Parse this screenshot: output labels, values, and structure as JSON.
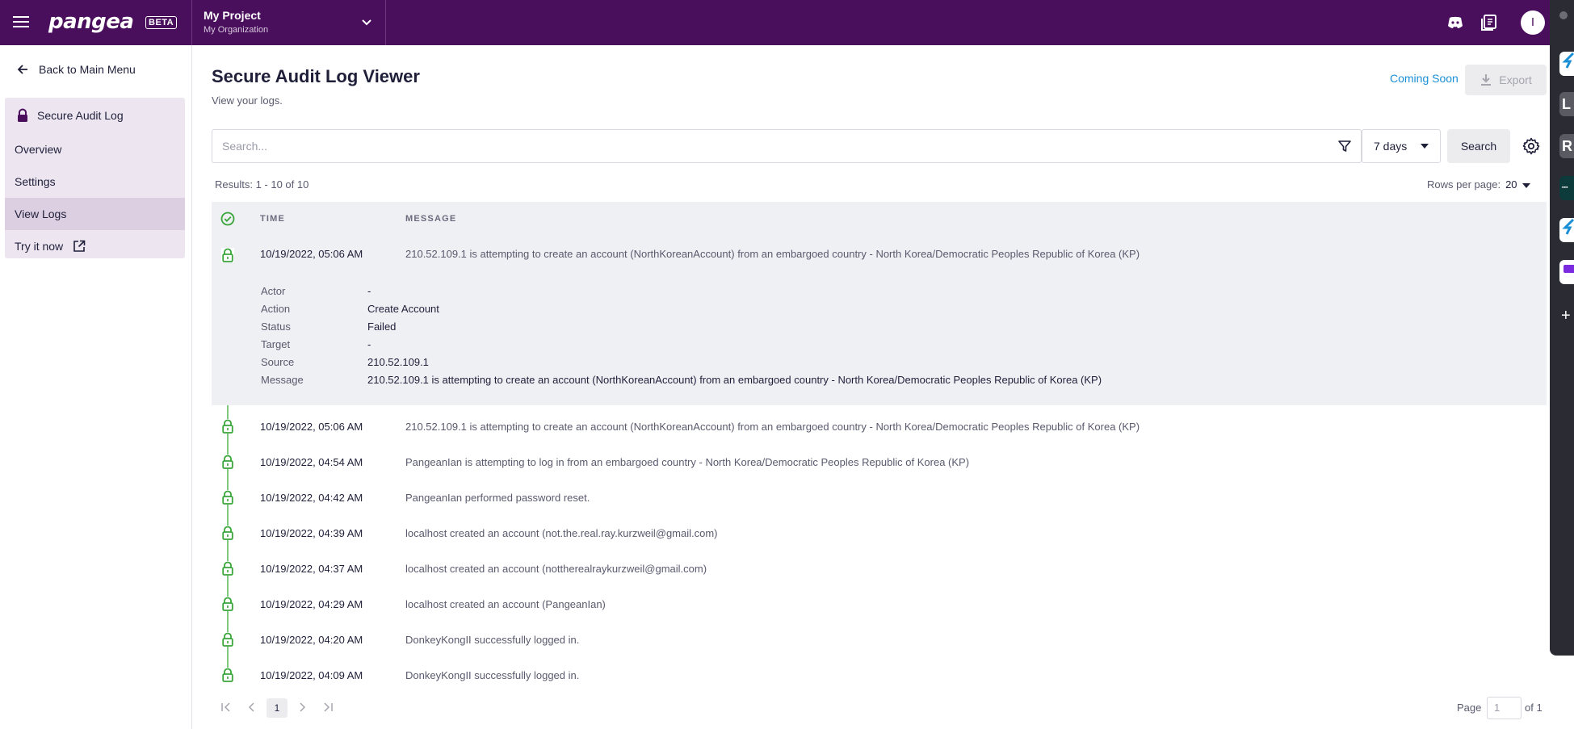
{
  "app": {
    "logo_text": "pangea",
    "badge": "BETA",
    "project_name": "My Project",
    "organization": "My Organization",
    "user_initial": "I"
  },
  "sidebar": {
    "back_label": "Back to Main Menu",
    "section_title": "Secure Audit Log",
    "items": [
      {
        "label": "Overview",
        "active": false
      },
      {
        "label": "Settings",
        "active": false
      },
      {
        "label": "View Logs",
        "active": true
      },
      {
        "label": "Try it now",
        "active": false,
        "external": true
      }
    ]
  },
  "page": {
    "title": "Secure Audit Log Viewer",
    "subtitle": "View your logs.",
    "coming_soon": "Coming Soon",
    "export_label": "Export"
  },
  "search": {
    "placeholder": "Search...",
    "range": "7 days",
    "button": "Search"
  },
  "results": {
    "summary": "Results: 1 - 10 of 10",
    "rows_per_page_label": "Rows per page:",
    "rows_per_page": "20"
  },
  "table": {
    "columns": [
      "TIME",
      "MESSAGE"
    ],
    "expanded_row": {
      "time": "10/19/2022, 05:06 AM",
      "message": "210.52.109.1 is attempting to create an account (NorthKoreanAccount) from an embargoed country - North Korea/Democratic Peoples Republic of Korea (KP)",
      "details": [
        {
          "key": "Actor",
          "value": "-"
        },
        {
          "key": "Action",
          "value": "Create Account"
        },
        {
          "key": "Status",
          "value": "Failed"
        },
        {
          "key": "Target",
          "value": "-"
        },
        {
          "key": "Source",
          "value": "210.52.109.1"
        },
        {
          "key": "Message",
          "value": "210.52.109.1 is attempting to create an account (NorthKoreanAccount) from an embargoed country - North Korea/Democratic Peoples Republic of Korea (KP)"
        }
      ]
    },
    "rows": [
      {
        "time": "10/19/2022, 05:06 AM",
        "message": "210.52.109.1 is attempting to create an account (NorthKoreanAccount) from an embargoed country - North Korea/Democratic Peoples Republic of Korea (KP)"
      },
      {
        "time": "10/19/2022, 04:54 AM",
        "message": "PangeanIan is attempting to log in from an embargoed country - North Korea/Democratic Peoples Republic of Korea (KP)"
      },
      {
        "time": "10/19/2022, 04:42 AM",
        "message": "PangeanIan performed password reset."
      },
      {
        "time": "10/19/2022, 04:39 AM",
        "message": "localhost created an account (not.the.real.ray.kurzweil@gmail.com)"
      },
      {
        "time": "10/19/2022, 04:37 AM",
        "message": "localhost created an account (nottherealraykurzweil@gmail.com)"
      },
      {
        "time": "10/19/2022, 04:29 AM",
        "message": "localhost created an account (PangeanIan)"
      },
      {
        "time": "10/19/2022, 04:20 AM",
        "message": "DonkeyKongII successfully logged in."
      },
      {
        "time": "10/19/2022, 04:09 AM",
        "message": "DonkeyKongII successfully logged in."
      }
    ]
  },
  "pagination": {
    "current_page": "1",
    "page_label": "Page",
    "page_input": "1",
    "of_label": "of 1"
  },
  "side_strip": {
    "apps": [
      "L",
      "R"
    ]
  },
  "colors": {
    "topbar": "#4a0f5c",
    "accent_link": "#1a8fd6",
    "timeline_green": "#3aa53a"
  }
}
